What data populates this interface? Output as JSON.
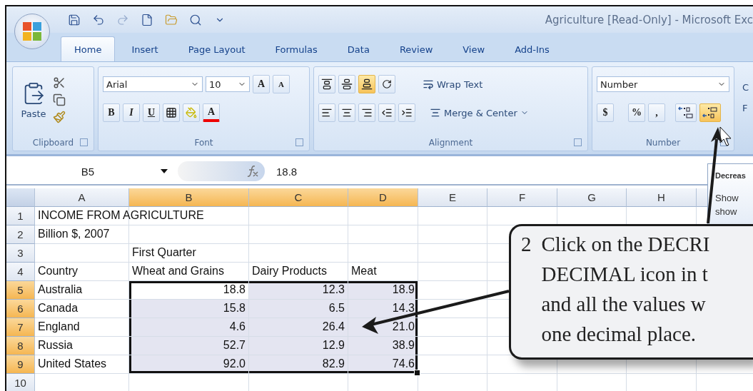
{
  "window": {
    "title": "Agriculture  [Read-Only] - Microsoft Exc"
  },
  "tabs": [
    {
      "label": "Home",
      "selected": true
    },
    {
      "label": "Insert",
      "selected": false
    },
    {
      "label": "Page Layout",
      "selected": false
    },
    {
      "label": "Formulas",
      "selected": false
    },
    {
      "label": "Data",
      "selected": false
    },
    {
      "label": "Review",
      "selected": false
    },
    {
      "label": "View",
      "selected": false
    },
    {
      "label": "Add-Ins",
      "selected": false
    }
  ],
  "ribbon": {
    "clipboard": {
      "label": "Clipboard",
      "paste": "Paste"
    },
    "font": {
      "label": "Font",
      "font_name": "Arial",
      "font_size": "10",
      "grow": "A",
      "shrink": "A",
      "bold": "B",
      "italic": "I",
      "underline": "U",
      "font_color": "A"
    },
    "alignment": {
      "label": "Alignment",
      "wrap": "Wrap Text",
      "merge": "Merge & Center"
    },
    "number": {
      "label": "Number",
      "format": "Number",
      "currency": "$",
      "percent": "%",
      "comma": ",",
      "decrease_hovered": true
    },
    "styles": {
      "letters": [
        "C",
        "F"
      ]
    }
  },
  "formula_bar": {
    "name_box": "B5",
    "formula": "18.8"
  },
  "sheet": {
    "columns": [
      {
        "label": "A",
        "selected": false
      },
      {
        "label": "B",
        "selected": true
      },
      {
        "label": "C",
        "selected": true
      },
      {
        "label": "D",
        "selected": true
      },
      {
        "label": "E",
        "selected": false
      },
      {
        "label": "F",
        "selected": false
      },
      {
        "label": "G",
        "selected": false
      },
      {
        "label": "H",
        "selected": false
      }
    ],
    "rows": [
      {
        "number": "1",
        "selected": false,
        "cells": [
          {
            "kind": "text",
            "text": "INCOME FROM AGRICULTURE"
          }
        ]
      },
      {
        "number": "2",
        "selected": false,
        "cells": [
          {
            "kind": "text",
            "text": "Billion $, 2007"
          }
        ]
      },
      {
        "number": "3",
        "selected": false,
        "cells": [
          {
            "kind": "blank"
          },
          {
            "kind": "text",
            "text": "First Quarter"
          }
        ]
      },
      {
        "number": "4",
        "selected": false,
        "cells": [
          {
            "kind": "text",
            "text": "Country"
          },
          {
            "kind": "text",
            "text": "Wheat and Grains"
          },
          {
            "kind": "text",
            "text": "Dairy Products"
          },
          {
            "kind": "text",
            "text": "Meat"
          }
        ]
      },
      {
        "number": "5",
        "selected": true,
        "cells": [
          {
            "kind": "text",
            "text": "Australia"
          },
          {
            "kind": "number",
            "text": "18.8"
          },
          {
            "kind": "number",
            "text": "12.3"
          },
          {
            "kind": "number",
            "text": "18.9"
          }
        ]
      },
      {
        "number": "6",
        "selected": true,
        "cells": [
          {
            "kind": "text",
            "text": "Canada"
          },
          {
            "kind": "number",
            "text": "15.8"
          },
          {
            "kind": "number",
            "text": "6.5"
          },
          {
            "kind": "number",
            "text": "14.3"
          }
        ]
      },
      {
        "number": "7",
        "selected": true,
        "cells": [
          {
            "kind": "text",
            "text": "England"
          },
          {
            "kind": "number",
            "text": "4.6"
          },
          {
            "kind": "number",
            "text": "26.4"
          },
          {
            "kind": "number",
            "text": "21.0"
          }
        ]
      },
      {
        "number": "8",
        "selected": true,
        "cells": [
          {
            "kind": "text",
            "text": "Russia"
          },
          {
            "kind": "number",
            "text": "52.7"
          },
          {
            "kind": "number",
            "text": "12.9"
          },
          {
            "kind": "number",
            "text": "38.9"
          }
        ]
      },
      {
        "number": "9",
        "selected": true,
        "cells": [
          {
            "kind": "text",
            "text": "United States"
          },
          {
            "kind": "number",
            "text": "92.0"
          },
          {
            "kind": "number",
            "text": "82.9"
          },
          {
            "kind": "number",
            "text": "74.6"
          }
        ]
      },
      {
        "number": "10",
        "selected": false
      }
    ]
  },
  "tooltip": {
    "title": "Decreas",
    "lines": [
      "Show",
      "show"
    ]
  },
  "callout": {
    "step": "2",
    "lines": [
      "Click on the DECRI",
      "DECIMAL icon in t",
      "and all the values w",
      "one decimal place."
    ]
  }
}
